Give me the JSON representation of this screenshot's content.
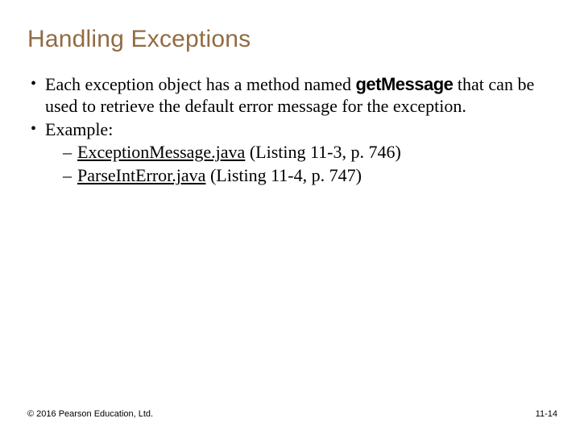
{
  "title": "Handling Exceptions",
  "bullets": {
    "b1_pre": "Each exception object has a method named ",
    "b1_code": "getMessage",
    "b1_post": " that can be used to retrieve the default error message for the exception.",
    "b2": "Example:",
    "b2_sub1_link": "ExceptionMessage.java",
    "b2_sub1_rest": " (Listing 11-3, p. 746)",
    "b2_sub2_link": "ParseIntError.java",
    "b2_sub2_rest": " (Listing 11-4, p. 747)"
  },
  "footer": {
    "copyright": "© 2016 Pearson Education, Ltd.",
    "pagenum": "11-14"
  }
}
